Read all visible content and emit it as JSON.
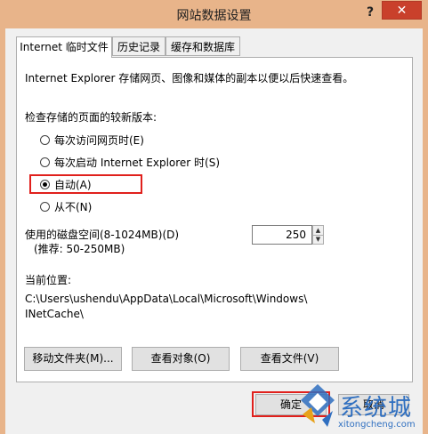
{
  "window": {
    "title": "网站数据设置",
    "help_label": "?",
    "close_label": "✕"
  },
  "tabs": [
    {
      "label": "Internet 临时文件",
      "active": true
    },
    {
      "label": "历史记录",
      "active": false
    },
    {
      "label": "缓存和数据库",
      "active": false
    }
  ],
  "intro_text": "Internet Explorer 存储网页、图像和媒体的副本以便以后快速查看。",
  "check_label": "检查存储的页面的较新版本:",
  "options": [
    {
      "label": "每次访问网页时(E)",
      "selected": false
    },
    {
      "label": "每次启动 Internet Explorer 时(S)",
      "selected": false
    },
    {
      "label": "自动(A)",
      "selected": true
    },
    {
      "label": "从不(N)",
      "selected": false
    }
  ],
  "disk": {
    "label": "使用的磁盘空间(8-1024MB)(D)",
    "recommend": "(推荐: 50-250MB)",
    "value": "250"
  },
  "location": {
    "label": "当前位置:",
    "path_line1": "C:\\Users\\ushendu\\AppData\\Local\\Microsoft\\Windows\\",
    "path_line2": "INetCache\\"
  },
  "buttons": {
    "move_folder": "移动文件夹(M)...",
    "view_objects": "查看对象(O)",
    "view_files": "查看文件(V)",
    "ok": "确定",
    "cancel": "取消"
  },
  "watermark": {
    "brand": "系统城",
    "url": "xitongcheng.com"
  },
  "colors": {
    "titlebar": "#e8b48a",
    "close": "#c9402b",
    "highlight": "#e0201c"
  }
}
